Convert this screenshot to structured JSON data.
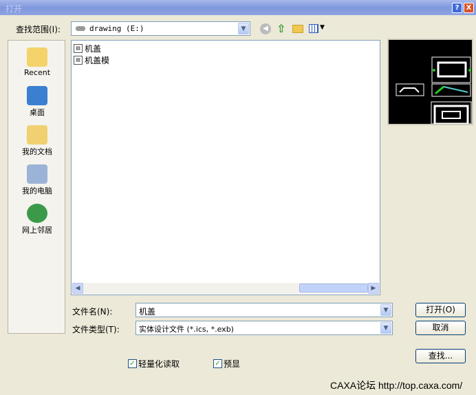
{
  "window": {
    "title": "打开",
    "help_label": "?",
    "close_label": "X"
  },
  "lookin": {
    "label": "查找范围(I):",
    "value": "drawing (E:)"
  },
  "toolbar": {
    "back_icon": "back-icon",
    "up_icon": "up-folder-icon",
    "new_folder_icon": "new-folder-icon",
    "views_icon": "views-menu-icon"
  },
  "places": [
    {
      "label": "Recent"
    },
    {
      "label": "桌面"
    },
    {
      "label": "我的文档"
    },
    {
      "label": "我的电脑"
    },
    {
      "label": "网上邻居"
    }
  ],
  "files": [
    {
      "name": "机盖"
    },
    {
      "name": "机盖模"
    }
  ],
  "filename": {
    "label": "文件名(N):",
    "value": "机盖"
  },
  "filetype": {
    "label": "文件类型(T):",
    "value": "实体设计文件 (*.ics, *.exb)"
  },
  "buttons": {
    "open": "打开(O)",
    "cancel": "取消",
    "find": "查找..."
  },
  "options": {
    "lightweight": {
      "label": "轻量化读取",
      "checked": true
    },
    "preview": {
      "label": "预显",
      "checked": true
    }
  },
  "watermark": "CAXA论坛 http://top.caxa.com/"
}
